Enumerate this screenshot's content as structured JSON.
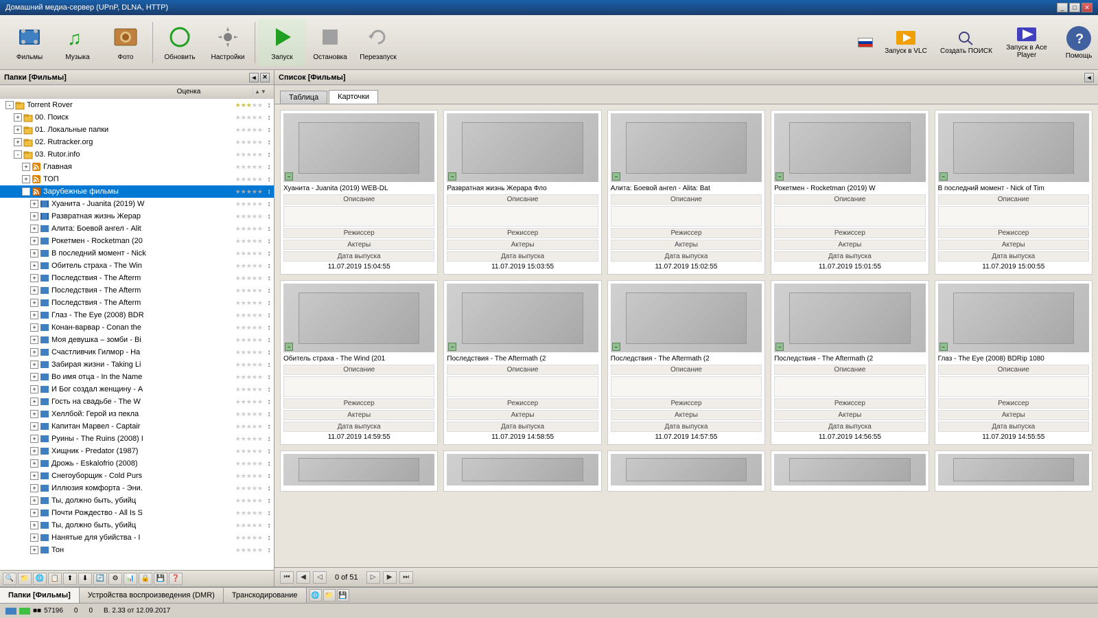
{
  "app": {
    "title": "Домашний медиа-сервер (UPnP, DLNA, HTTP)",
    "title_buttons": [
      "_",
      "□",
      "✕"
    ]
  },
  "toolbar": {
    "buttons": [
      {
        "id": "films",
        "label": "Фильмы",
        "icon": "🎬"
      },
      {
        "id": "music",
        "label": "Музыка",
        "icon": "🎵"
      },
      {
        "id": "photo",
        "label": "Фото",
        "icon": "📷"
      },
      {
        "id": "update",
        "label": "Обновить",
        "icon": "🔄"
      },
      {
        "id": "settings",
        "label": "Настройки",
        "icon": "⚙"
      },
      {
        "id": "launch",
        "label": "Запуск",
        "icon": "▶"
      },
      {
        "id": "stop",
        "label": "Остановка",
        "icon": "⏹"
      },
      {
        "id": "restart",
        "label": "Перезапуск",
        "icon": "🔁"
      }
    ],
    "right_buttons": [
      {
        "id": "vlc",
        "label": "Запуск в VLC",
        "icon": "▶"
      },
      {
        "id": "search",
        "label": "Создать ПОИСК",
        "icon": "🔍"
      },
      {
        "id": "ace",
        "label": "Запуск в Ace Player",
        "icon": "▶"
      }
    ],
    "help_label": "Помощь"
  },
  "left_panel": {
    "title": "Папки [Фильмы]",
    "headers": [
      "Оценка"
    ],
    "tree": [
      {
        "id": "torrent_rover",
        "label": "Torrent Rover",
        "level": 0,
        "expanded": true,
        "type": "folder"
      },
      {
        "id": "search",
        "label": "00. Поиск",
        "level": 1,
        "expanded": false,
        "type": "folder"
      },
      {
        "id": "local",
        "label": "01. Локальные папки",
        "level": 1,
        "expanded": false,
        "type": "folder"
      },
      {
        "id": "rutracker",
        "label": "02. Rutracker.org",
        "level": 1,
        "expanded": false,
        "type": "folder"
      },
      {
        "id": "rutor",
        "label": "03. Rutor.info",
        "level": 1,
        "expanded": true,
        "type": "folder"
      },
      {
        "id": "main",
        "label": "Главная",
        "level": 2,
        "expanded": false,
        "type": "rss"
      },
      {
        "id": "top",
        "label": "ТОП",
        "level": 2,
        "expanded": false,
        "type": "rss"
      },
      {
        "id": "foreign",
        "label": "Зарубежные фильмы",
        "level": 2,
        "expanded": true,
        "type": "rss",
        "selected": true
      },
      {
        "id": "juanita",
        "label": "Хуанита - Juanita (2019) W",
        "level": 3,
        "expanded": false,
        "type": "item"
      },
      {
        "id": "depraved",
        "label": "Развратная жизнь Жерар",
        "level": 3,
        "expanded": false,
        "type": "item"
      },
      {
        "id": "alita",
        "label": "Алита: Боевой ангел - Alit",
        "level": 3,
        "expanded": false,
        "type": "item"
      },
      {
        "id": "rocketman",
        "label": "Рокетмен - Rocketman (20",
        "level": 3,
        "expanded": false,
        "type": "item"
      },
      {
        "id": "lastmoment",
        "label": "В последний момент - Nick",
        "level": 3,
        "expanded": false,
        "type": "item"
      },
      {
        "id": "wind",
        "label": "Обитель страха - The Win",
        "level": 3,
        "expanded": false,
        "type": "item"
      },
      {
        "id": "aftermath1",
        "label": "Последствия - The Afterm",
        "level": 3,
        "expanded": false,
        "type": "item"
      },
      {
        "id": "aftermath2",
        "label": "Последствия - The Afterm",
        "level": 3,
        "expanded": false,
        "type": "item"
      },
      {
        "id": "aftermath3",
        "label": "Последствия - The Afterm",
        "level": 3,
        "expanded": false,
        "type": "item"
      },
      {
        "id": "eye",
        "label": "Глаз - The Eye (2008) BDR",
        "level": 3,
        "expanded": false,
        "type": "item"
      },
      {
        "id": "conan",
        "label": "Конан-варвар - Conan the",
        "level": 3,
        "expanded": false,
        "type": "item"
      },
      {
        "id": "zombie",
        "label": "Моя девушка – зомби - Bi",
        "level": 3,
        "expanded": false,
        "type": "item"
      },
      {
        "id": "gilmore",
        "label": "Счастливчик Гилмор - Ha",
        "level": 3,
        "expanded": false,
        "type": "item"
      },
      {
        "id": "taking",
        "label": "Забирая жизни - Taking Li",
        "level": 3,
        "expanded": false,
        "type": "item"
      },
      {
        "id": "father",
        "label": "Во имя отца - In the Name",
        "level": 3,
        "expanded": false,
        "type": "item"
      },
      {
        "id": "god",
        "label": "И Бог создал женщину - A",
        "level": 3,
        "expanded": false,
        "type": "item"
      },
      {
        "id": "wedding",
        "label": "Гость на свадьбе - The W",
        "level": 3,
        "expanded": false,
        "type": "item"
      },
      {
        "id": "hellboy",
        "label": "Хеллбой: Герой из пекла",
        "level": 3,
        "expanded": false,
        "type": "item"
      },
      {
        "id": "captain",
        "label": "Капитан Марвел - Captair",
        "level": 3,
        "expanded": false,
        "type": "item"
      },
      {
        "id": "ruins",
        "label": "Руины - The Ruins (2008) I",
        "level": 3,
        "expanded": false,
        "type": "item"
      },
      {
        "id": "predator",
        "label": "Хищник - Predator (1987)",
        "level": 3,
        "expanded": false,
        "type": "item"
      },
      {
        "id": "eskalofrio",
        "label": "Дрожь - Eskalofrio (2008)",
        "level": 3,
        "expanded": false,
        "type": "item"
      },
      {
        "id": "snowpiercer",
        "label": "Снегоуборщик - Cold Purs",
        "level": 3,
        "expanded": false,
        "type": "item"
      },
      {
        "id": "comfort",
        "label": "Иллюзия комфорта - Эни.",
        "level": 3,
        "expanded": false,
        "type": "item"
      },
      {
        "id": "killer1",
        "label": "Ты, должно быть, убийц",
        "level": 3,
        "expanded": false,
        "type": "item"
      },
      {
        "id": "christmas",
        "label": "Почти Рождество - All Is S",
        "level": 3,
        "expanded": false,
        "type": "item"
      },
      {
        "id": "killer2",
        "label": "Ты, должно быть, убийц",
        "level": 3,
        "expanded": false,
        "type": "item"
      },
      {
        "id": "hired",
        "label": "Нанятые для убийства - I",
        "level": 3,
        "expanded": false,
        "type": "item"
      },
      {
        "id": "ton",
        "label": "Тон",
        "level": 3,
        "expanded": false,
        "type": "item"
      }
    ]
  },
  "right_panel": {
    "title": "Список [Фильмы]",
    "tabs": [
      {
        "id": "table",
        "label": "Таблица",
        "active": false
      },
      {
        "id": "cards",
        "label": "Карточки",
        "active": true
      }
    ],
    "cards": [
      {
        "id": 1,
        "title": "Хуанита - Juanita (2019) WEB-DL",
        "description_label": "Описание",
        "director_label": "Режиссер",
        "actors_label": "Актеры",
        "date_label": "Дата выпуска",
        "date_value": "11.07.2019 15:04:55",
        "has_indicator": true
      },
      {
        "id": 2,
        "title": "Развратная жизнь Жерара Фло",
        "description_label": "Описание",
        "director_label": "Режиссер",
        "actors_label": "Актеры",
        "date_label": "Дата выпуска",
        "date_value": "11.07.2019 15:03:55",
        "has_indicator": true
      },
      {
        "id": 3,
        "title": "Алита: Боевой ангел - Alita: Bat",
        "description_label": "Описание",
        "director_label": "Режиссер",
        "actors_label": "Актеры",
        "date_label": "Дата выпуска",
        "date_value": "11.07.2019 15:02:55",
        "has_indicator": true
      },
      {
        "id": 4,
        "title": "Рокетмен - Rocketman (2019) W",
        "description_label": "Описание",
        "director_label": "Режиссер",
        "actors_label": "Актеры",
        "date_label": "Дата выпуска",
        "date_value": "11.07.2019 15:01:55",
        "has_indicator": true
      },
      {
        "id": 5,
        "title": "В последний момент - Nick of Tim",
        "description_label": "Описание",
        "director_label": "Режиссер",
        "actors_label": "Актеры",
        "date_label": "Дата выпуска",
        "date_value": "11.07.2019 15:00:55",
        "has_indicator": true
      },
      {
        "id": 6,
        "title": "Обитель страха - The Wind (201",
        "description_label": "Описание",
        "director_label": "Режиссер",
        "actors_label": "Актеры",
        "date_label": "Дата выпуска",
        "date_value": "11.07.2019 14:59:55",
        "has_indicator": true
      },
      {
        "id": 7,
        "title": "Последствия - The Aftermath (2",
        "description_label": "Описание",
        "director_label": "Режиссер",
        "actors_label": "Актеры",
        "date_label": "Дата выпуска",
        "date_value": "11.07.2019 14:58:55",
        "has_indicator": true
      },
      {
        "id": 8,
        "title": "Последствия - The Aftermath (2",
        "description_label": "Описание",
        "director_label": "Режиссер",
        "actors_label": "Актеры",
        "date_label": "Дата выпуска",
        "date_value": "11.07.2019 14:57:55",
        "has_indicator": true
      },
      {
        "id": 9,
        "title": "Последствия - The Aftermath (2",
        "description_label": "Описание",
        "director_label": "Режиссер",
        "actors_label": "Актеры",
        "date_label": "Дата выпуска",
        "date_value": "11.07.2019 14:56:55",
        "has_indicator": true
      },
      {
        "id": 10,
        "title": "Глаз - The Eye (2008) BDRip 1080",
        "description_label": "Описание",
        "director_label": "Режиссер",
        "actors_label": "Актеры",
        "date_label": "Дата выпуска",
        "date_value": "11.07.2019 14:55:55",
        "has_indicator": true
      }
    ]
  },
  "pagination": {
    "current": "0 of 51",
    "first_label": "⏮",
    "prev_label": "◀",
    "prev_page_label": "◁",
    "next_page_label": "▷",
    "next_label": "▶",
    "last_label": "⏭"
  },
  "bottom_tabs": [
    {
      "id": "folders",
      "label": "Папки [Фильмы]",
      "active": true
    },
    {
      "id": "devices",
      "label": "Устройства воспроизведения (DMR)",
      "active": false
    },
    {
      "id": "transcoding",
      "label": "Транскодирование",
      "active": false
    }
  ],
  "status_bar": {
    "items": [
      "57196",
      "0",
      "0",
      "В. 2.33 от 12.09.2017"
    ]
  },
  "bottom_toolbar": {
    "buttons": [
      "🔍",
      "📁",
      "🌐",
      "📋",
      "⬆",
      "⬇",
      "🔄",
      "⚙",
      "📊",
      "🔒",
      "💾",
      "❓"
    ]
  }
}
